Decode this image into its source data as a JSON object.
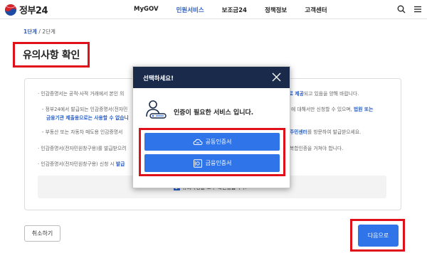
{
  "header": {
    "logo_text": "정부24",
    "nav": [
      "MyGOV",
      "민원서비스",
      "보조금24",
      "정책정보",
      "고객센터"
    ],
    "active_nav_index": 1,
    "accent_color": "#2b60c8"
  },
  "breadcrumb": {
    "step_current": "1단계",
    "separator": " / ",
    "step_next": "2단계"
  },
  "page_title": "유의사항 확인",
  "notices": {
    "b1_a": "· 인감증명서는 공적·사적 거래에서 본인 의",
    "b1_hl": "관적으로 제공",
    "b1_b": "되고 있음을 양해 바랍니다.",
    "b2_a": "- 정부24에서 발급되는 인감증명서(전자민",
    "b2_b": "에 대해서만 신청할 수 있으며, ",
    "b2_hl": "법원 또는",
    "b3_hl": "금융기관 제출용으로는 사용할 수 없습니",
    "b4_a": "- 부동산 또는 자동차 매도용 인감증명서",
    "b4_hl": "주민센터",
    "b4_b": "를 방문하여 발급받으세요.",
    "b5_a": "· 인감증명서(전자민원창구용)를 발급받으려",
    "b5_b": "복합인증을 거쳐야 합니다.",
    "b6_a": "· 인감증명서(전자민원창구용) 신청 시 ",
    "b6_hl": "발급"
  },
  "confirm_label": "유의사항을 모두 확인했습니다.",
  "buttons": {
    "cancel": "취소하기",
    "next": "다음으로"
  },
  "modal": {
    "title": "선택하세요!",
    "message": "인증이 필요한 서비스 입니다.",
    "public_cert": "공동인증서",
    "finance_cert": "금융인증서"
  }
}
